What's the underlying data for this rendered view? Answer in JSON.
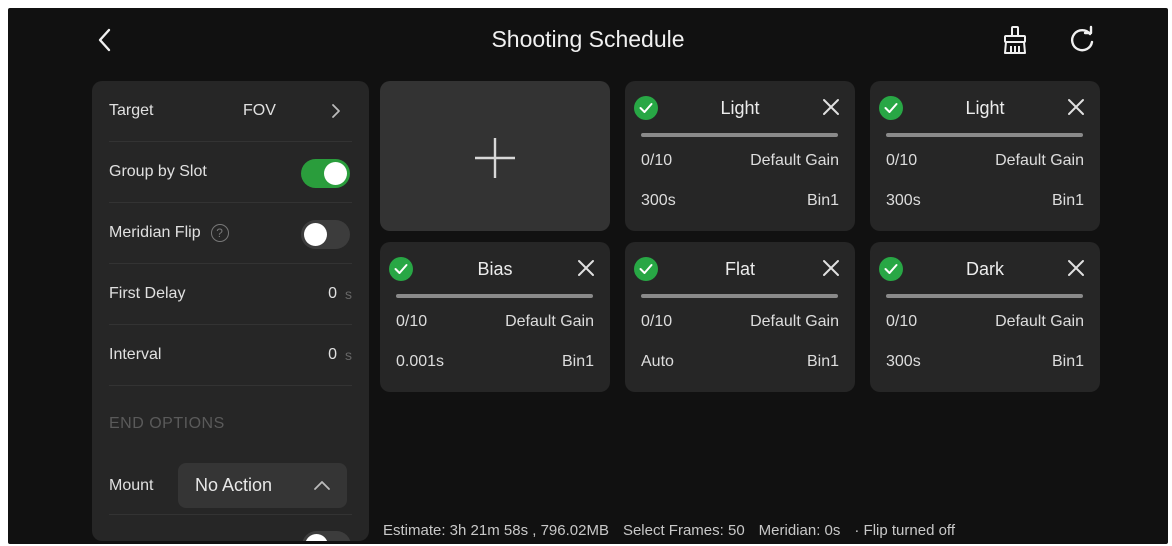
{
  "header": {
    "title": "Shooting Schedule"
  },
  "settings": {
    "target": {
      "label": "Target",
      "value": "FOV"
    },
    "group_by_slot": {
      "label": "Group by Slot",
      "on": true
    },
    "meridian_flip": {
      "label": "Meridian Flip",
      "on": false,
      "help_glyph": "?"
    },
    "first_delay": {
      "label": "First Delay",
      "value": "0",
      "unit": "s"
    },
    "interval": {
      "label": "Interval",
      "value": "0",
      "unit": "s"
    },
    "end_options_heading": "END OPTIONS",
    "mount": {
      "label": "Mount",
      "selected": "No Action"
    }
  },
  "cards": [
    {
      "title": "Light",
      "count": "0/10",
      "gain": "Default Gain",
      "exposure": "300s",
      "bin": "Bin1",
      "checked": true
    },
    {
      "title": "Light",
      "count": "0/10",
      "gain": "Default Gain",
      "exposure": "300s",
      "bin": "Bin1",
      "checked": true
    },
    {
      "title": "Bias",
      "count": "0/10",
      "gain": "Default Gain",
      "exposure": "0.001s",
      "bin": "Bin1",
      "checked": true
    },
    {
      "title": "Flat",
      "count": "0/10",
      "gain": "Default Gain",
      "exposure": "Auto",
      "bin": "Bin1",
      "checked": true
    },
    {
      "title": "Dark",
      "count": "0/10",
      "gain": "Default Gain",
      "exposure": "300s",
      "bin": "Bin1",
      "checked": true
    }
  ],
  "footer": {
    "estimate": "Estimate:  3h 21m 58s , 796.02MB",
    "select_frames": "Select Frames: 50",
    "meridian": "Meridian: 0s",
    "flip_status": "· Flip turned off"
  },
  "colors": {
    "background": "#111111",
    "panel": "#262626",
    "accent_green": "#28a745"
  },
  "icons": [
    "back-chevron-icon",
    "broom-icon",
    "refresh-icon",
    "plus-icon",
    "check-icon",
    "close-icon",
    "chevron-right-icon",
    "chevron-up-icon",
    "help-icon"
  ]
}
